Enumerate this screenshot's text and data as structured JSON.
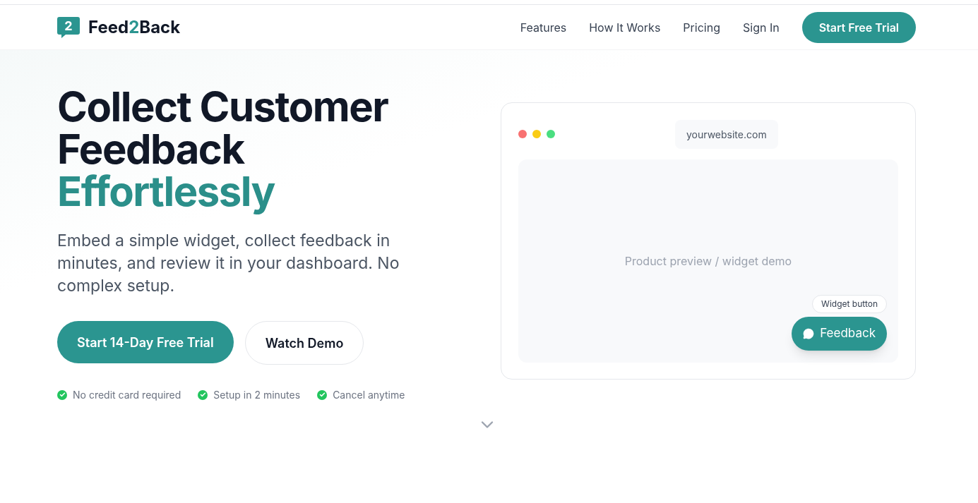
{
  "logo": {
    "badge": "2",
    "parts": [
      {
        "text": "Feed",
        "accent": false
      },
      {
        "text": "2",
        "accent": true
      },
      {
        "text": "Back",
        "accent": false
      }
    ]
  },
  "nav": {
    "links": [
      "Features",
      "How It Works",
      "Pricing",
      "Sign In"
    ],
    "cta": "Start Free Trial"
  },
  "hero": {
    "headline": [
      {
        "text": "Collect Customer",
        "accent": false
      },
      {
        "text": "Feedback",
        "accent": false
      },
      {
        "text": "Effortlessly",
        "accent": true
      }
    ],
    "subtitle": "Embed a simple widget, collect feedback in minutes, and review it in your dashboard. No complex setup.",
    "primary_button": "Start 14-Day Free Trial",
    "secondary_button": "Watch Demo",
    "benefits": [
      "No credit card required",
      "Setup in 2 minutes",
      "Cancel anytime"
    ]
  },
  "preview": {
    "window_dots": [
      {
        "color": "#f87171"
      },
      {
        "color": "#facc15"
      },
      {
        "color": "#4ade80"
      }
    ],
    "url": "yourwebsite.com",
    "placeholder_text": "Product preview / widget demo",
    "widget_label": "Widget button",
    "widget_button": "Feedback"
  }
}
